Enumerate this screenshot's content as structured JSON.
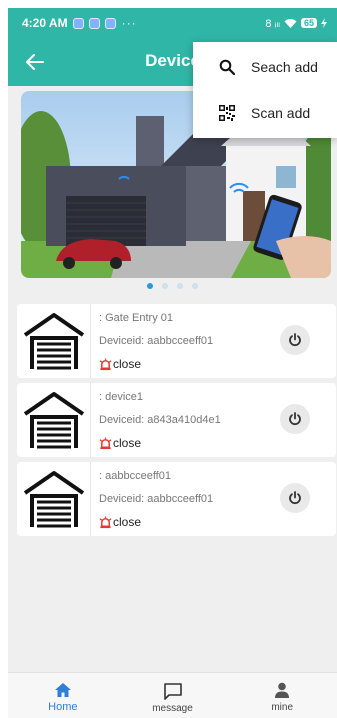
{
  "statusbar": {
    "time": "4:20 AM",
    "dots": "···",
    "signal": "8 ᵢₗₗ",
    "battery": "65"
  },
  "appbar": {
    "title": "Device"
  },
  "menu": {
    "items": [
      {
        "label": "Seach add",
        "icon": "search-icon"
      },
      {
        "label": "Scan add",
        "icon": "qr-code-icon"
      }
    ]
  },
  "banner": {
    "slide_count": 4,
    "active_slide": 1
  },
  "devices": [
    {
      "name": ": Gate Entry 01",
      "deviceid": "Deviceid: aabbcceeff01",
      "status": "close"
    },
    {
      "name": ": device1",
      "deviceid": "Deviceid: a843a410d4e1",
      "status": "close"
    },
    {
      "name": ": aabbcceeff01",
      "deviceid": "Deviceid: aabbcceeff01",
      "status": "close"
    }
  ],
  "tabs": [
    {
      "label": "Home",
      "icon": "home-icon",
      "active": true
    },
    {
      "label": "message",
      "icon": "message-icon",
      "active": false
    },
    {
      "label": "mine",
      "icon": "person-icon",
      "active": false
    }
  ],
  "colors": {
    "accent": "#2fb6a6",
    "active_tab": "#2f7fd6",
    "alarm": "#e53935"
  }
}
